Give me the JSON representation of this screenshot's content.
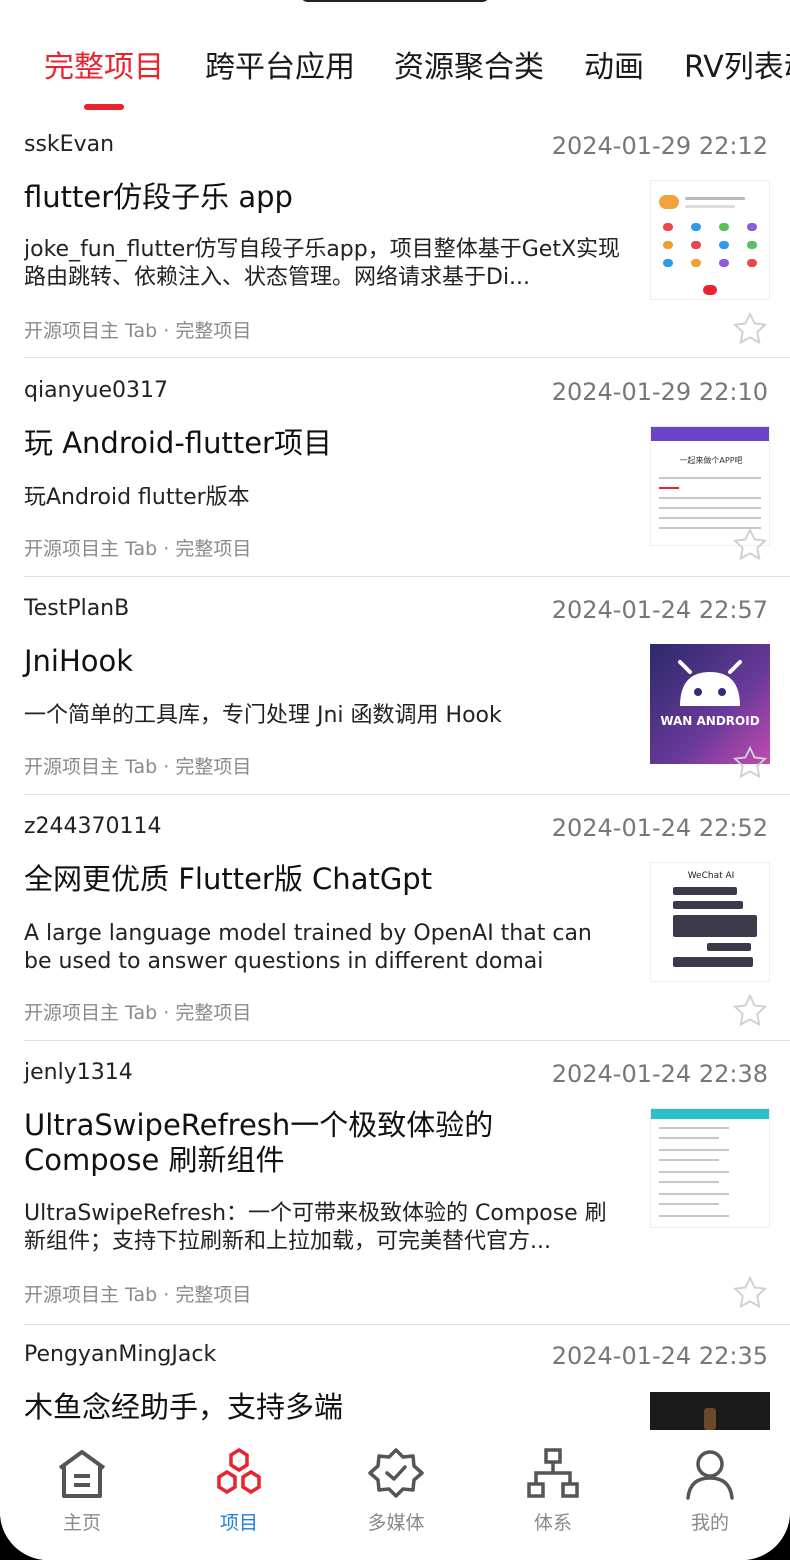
{
  "tabs": [
    {
      "label": "完整项目"
    },
    {
      "label": "跨平台应用"
    },
    {
      "label": "资源聚合类"
    },
    {
      "label": "动画"
    },
    {
      "label": "RV列表动"
    }
  ],
  "items": [
    {
      "author": "sskEvan",
      "date": "2024-01-29 22:12",
      "title": "flutter仿段子乐 app",
      "desc": "joke_fun_flutter仿写自段子乐app，项目整体基于GetX实现路由跳转、依赖注入、状态管理。网络请求基于Di...",
      "meta": "开源项目主 Tab · 完整项目",
      "thumb_icon": "app-screenshot-thumbnail"
    },
    {
      "author": "qianyue0317",
      "date": "2024-01-29 22:10",
      "title": "玩 Android-flutter项目",
      "desc": "玩Android flutter版本",
      "meta": "开源项目主 Tab · 完整项目",
      "thumb_icon": "app-screenshot-thumbnail",
      "thumb_caption": "一起来做个APP吧"
    },
    {
      "author": "TestPlanB",
      "date": "2024-01-24 22:57",
      "title": "JniHook",
      "desc": "一个简单的工具库，专门处理 Jni 函数调用 Hook",
      "meta": "开源项目主 Tab · 完整项目",
      "thumb_icon": "wan-android-logo",
      "thumb_caption": "WAN ANDROID"
    },
    {
      "author": "z244370114",
      "date": "2024-01-24 22:52",
      "title": "全网更优质 Flutter版 ChatGpt",
      "desc": "A large language model trained by OpenAI that can be used to answer questions in different domai",
      "meta": "开源项目主 Tab · 完整项目",
      "thumb_icon": "chat-screenshot-thumbnail",
      "thumb_caption": "WeChat AI"
    },
    {
      "author": "jenly1314",
      "date": "2024-01-24 22:38",
      "title": "UltraSwipeRefresh一个极致体验的 Compose 刷新组件",
      "desc": "UltraSwipeRefresh：一个可带来极致体验的 Compose 刷新组件；支持下拉刷新和上拉加载，可完美替代官方...",
      "meta": "开源项目主 Tab · 完整项目",
      "thumb_icon": "list-screenshot-thumbnail"
    },
    {
      "author": "PengyanMingJack",
      "date": "2024-01-24 22:35",
      "title": "木鱼念经助手，支持多端",
      "desc": "",
      "meta": "",
      "thumb_icon": "dark-app-thumbnail"
    }
  ],
  "nav": [
    {
      "label": "主页",
      "icon": "home-icon"
    },
    {
      "label": "项目",
      "icon": "hexagons-icon"
    },
    {
      "label": "多媒体",
      "icon": "badge-check-icon"
    },
    {
      "label": "体系",
      "icon": "hierarchy-icon"
    },
    {
      "label": "我的",
      "icon": "user-icon"
    }
  ],
  "colors": {
    "accent": "#e8242f",
    "nav_active": "#1e7fd9",
    "muted": "#8a8a8a"
  }
}
